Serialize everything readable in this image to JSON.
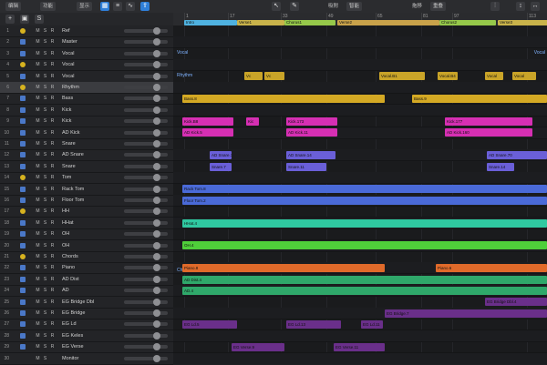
{
  "menubar": {
    "edit": "编辑",
    "functions": "功能",
    "view": "显示",
    "snap": "吸附",
    "snap_value": "智能",
    "drag": "拖移",
    "drag_value": "重叠"
  },
  "ruler": {
    "bars": [
      "1",
      "17",
      "33",
      "49",
      "65",
      "81",
      "97",
      "113"
    ],
    "markers": [
      {
        "label": "Intro",
        "color": "#4fb2e0"
      },
      {
        "label": "Verse1",
        "color": "#c9b34a"
      },
      {
        "label": "Chorus1",
        "color": "#96c84a"
      },
      {
        "label": "Verse2",
        "color": "#c9a24a"
      },
      {
        "label": "Chorus2",
        "color": "#96c84a"
      },
      {
        "label": "Verse3",
        "color": "#c9b34a"
      }
    ]
  },
  "tracks": [
    {
      "n": "1",
      "name": "Ref",
      "icon": "gold"
    },
    {
      "n": "2",
      "name": "Master",
      "icon": "blue"
    },
    {
      "n": "3",
      "name": "Vocal",
      "icon": "blue"
    },
    {
      "n": "4",
      "name": "Vocal",
      "icon": "gold"
    },
    {
      "n": "5",
      "name": "Vocal",
      "icon": "blue"
    },
    {
      "n": "6",
      "name": "Rhythm",
      "icon": "gold"
    },
    {
      "n": "7",
      "name": "Bass",
      "icon": "blue"
    },
    {
      "n": "8",
      "name": "Kick",
      "icon": "blue"
    },
    {
      "n": "9",
      "name": "Kick",
      "icon": "blue"
    },
    {
      "n": "10",
      "name": "AD Kick",
      "icon": "blue"
    },
    {
      "n": "11",
      "name": "Snare",
      "icon": "blue"
    },
    {
      "n": "12",
      "name": "AD Snare",
      "icon": "blue"
    },
    {
      "n": "13",
      "name": "Snare",
      "icon": "blue"
    },
    {
      "n": "14",
      "name": "Tom",
      "icon": "gold"
    },
    {
      "n": "15",
      "name": "Rack Tom",
      "icon": "blue"
    },
    {
      "n": "16",
      "name": "Floor Tom",
      "icon": "blue"
    },
    {
      "n": "17",
      "name": "HH",
      "icon": "gold"
    },
    {
      "n": "18",
      "name": "HHat",
      "icon": "blue"
    },
    {
      "n": "19",
      "name": "OH",
      "icon": "blue"
    },
    {
      "n": "20",
      "name": "OH",
      "icon": "blue"
    },
    {
      "n": "21",
      "name": "Chords",
      "icon": "gold"
    },
    {
      "n": "22",
      "name": "Piano",
      "icon": "blue"
    },
    {
      "n": "23",
      "name": "AD Dist",
      "icon": "blue"
    },
    {
      "n": "24",
      "name": "AD",
      "icon": "blue"
    },
    {
      "n": "25",
      "name": "EG Bridge Dbl",
      "icon": "blue"
    },
    {
      "n": "26",
      "name": "EG Bridge",
      "icon": "blue"
    },
    {
      "n": "27",
      "name": "EG Ld",
      "icon": "blue"
    },
    {
      "n": "28",
      "name": "EG Keles",
      "icon": "blue"
    },
    {
      "n": "29",
      "name": "EG Verse",
      "icon": "blue"
    },
    {
      "n": "30",
      "name": "Monitor",
      "icon": "none"
    }
  ],
  "folders": [
    "Vocal",
    "Vocal",
    "Rhythm",
    "Chords",
    "Chords"
  ],
  "regions": [
    {
      "track": 4,
      "label": "Vc",
      "color": "#c9a428"
    },
    {
      "track": 4,
      "label": "Vc",
      "color": "#c9a428"
    },
    {
      "track": 4,
      "label": "Vocal.B1",
      "color": "#c9a428"
    },
    {
      "track": 4,
      "label": "Vocal.B4",
      "color": "#c9a428"
    },
    {
      "track": 4,
      "label": "Vocal",
      "color": "#c9a428"
    },
    {
      "track": 4,
      "label": "Vocal",
      "color": "#c9a428"
    },
    {
      "track": 6,
      "label": "Bass.8",
      "color": "#d4a924"
    },
    {
      "track": 6,
      "label": "Bass.9",
      "color": "#d4a924"
    },
    {
      "track": 8,
      "label": "Kick.B8",
      "color": "#d62fb3"
    },
    {
      "track": 8,
      "label": "Kick.173",
      "color": "#d62fb3"
    },
    {
      "track": 8,
      "label": "Kic",
      "color": "#d62fb3"
    },
    {
      "track": 8,
      "label": "Kick.177",
      "color": "#d62fb3"
    },
    {
      "track": 9,
      "label": "AD Kick.5",
      "color": "#d62fb3"
    },
    {
      "track": 9,
      "label": "AD Kick.11",
      "color": "#d62fb3"
    },
    {
      "track": 9,
      "label": "AD Kick.160",
      "color": "#d62fb3"
    },
    {
      "track": 11,
      "label": "AD Snare.1",
      "color": "#6a5fd8"
    },
    {
      "track": 11,
      "label": "AD Snare.14",
      "color": "#6a5fd8"
    },
    {
      "track": 11,
      "label": "AD Snare.70",
      "color": "#6a5fd8"
    },
    {
      "track": 12,
      "label": "Snare.7",
      "color": "#6a5fd8"
    },
    {
      "track": 12,
      "label": "Snare.11",
      "color": "#6a5fd8"
    },
    {
      "track": 12,
      "label": "Snare.14",
      "color": "#6a5fd8"
    },
    {
      "track": 14,
      "label": "Rack Tom.8",
      "color": "#4a6ad8"
    },
    {
      "track": 15,
      "label": "Floor Tom.2",
      "color": "#4a6ad8"
    },
    {
      "track": 17,
      "label": "HHat.4",
      "color": "#2fc8a0"
    },
    {
      "track": 19,
      "label": "OH.4",
      "color": "#4fcf3a"
    },
    {
      "track": 21,
      "label": "Piano.8",
      "color": "#e06a2a"
    },
    {
      "track": 21,
      "label": "Piano.6",
      "color": "#e06a2a"
    },
    {
      "track": 22,
      "label": "AD Dist.4",
      "color": "#2fa86a"
    },
    {
      "track": 23,
      "label": "AD.4",
      "color": "#2fa86a"
    },
    {
      "track": 24,
      "label": "EG Bridge Dbl.4",
      "color": "#6a2f8a"
    },
    {
      "track": 25,
      "label": "EG Bridge.7",
      "color": "#6a2f8a"
    },
    {
      "track": 26,
      "label": "EG Ld.5",
      "color": "#6a2f8a"
    },
    {
      "track": 26,
      "label": "EG Ld.13",
      "color": "#6a2f8a"
    },
    {
      "track": 26,
      "label": "EG Ld.11",
      "color": "#6a2f8a"
    },
    {
      "track": 28,
      "label": "EG Verse.9",
      "color": "#6a2f8a"
    },
    {
      "track": 28,
      "label": "EG Verse.11",
      "color": "#6a2f8a"
    }
  ]
}
